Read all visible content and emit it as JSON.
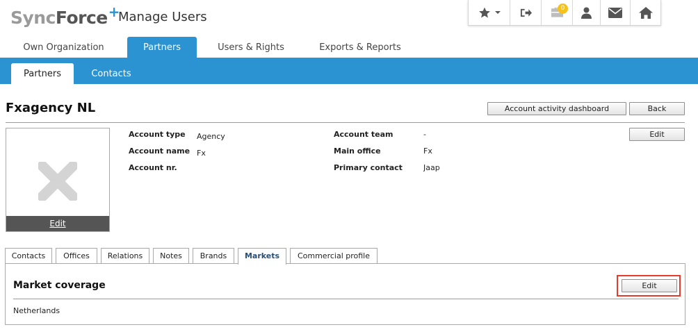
{
  "header": {
    "logo_sync": "Sync",
    "logo_force": "Force",
    "logo_plus": "+",
    "app_title": "Manage Users",
    "notification_count": "0",
    "icons": [
      "star-icon",
      "chevron-down-icon",
      "logout-icon",
      "briefcase-icon",
      "user-icon",
      "envelope-icon",
      "home-icon"
    ],
    "accent_color": "#2b93d1"
  },
  "topnav": {
    "tabs": [
      {
        "label": "Own Organization"
      },
      {
        "label": "Partners"
      },
      {
        "label": "Users & Rights"
      },
      {
        "label": "Exports & Reports"
      }
    ]
  },
  "subnav": {
    "tabs": [
      {
        "label": "Partners"
      },
      {
        "label": "Contacts"
      }
    ]
  },
  "page": {
    "title": "Fxagency NL",
    "dashboard_button": "Account activity dashboard",
    "back_button": "Back",
    "edit_button": "Edit"
  },
  "photo": {
    "edit_label": "Edit",
    "placeholder_icon": "x-icon"
  },
  "account": {
    "type_label": "Account type",
    "type_value": "Agency",
    "name_label": "Account name",
    "name_value": "Fx",
    "nr_label": "Account nr.",
    "nr_value": "",
    "team_label": "Account team",
    "team_value": "-",
    "office_label": "Main office",
    "office_value": "Fx",
    "contact_label": "Primary contact",
    "contact_value": "Jaap"
  },
  "detail_tabs": [
    {
      "label": "Contacts"
    },
    {
      "label": "Offices"
    },
    {
      "label": "Relations"
    },
    {
      "label": "Notes"
    },
    {
      "label": "Brands"
    },
    {
      "label": "Markets"
    },
    {
      "label": "Commercial profile"
    }
  ],
  "market": {
    "title": "Market coverage",
    "edit_button": "Edit",
    "value": "Netherlands",
    "highlight_color": "#e53b2c"
  }
}
